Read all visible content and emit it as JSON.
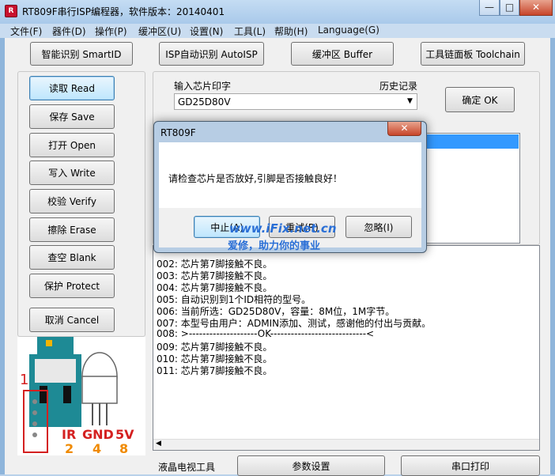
{
  "window": {
    "title": "RT809F串行ISP编程器，软件版本：20140401",
    "caption_buttons": [
      "—",
      "□",
      "✕"
    ]
  },
  "menu": [
    "文件(F)",
    "器件(D)",
    "操作(P)",
    "缓冲区(U)",
    "设置(N)",
    "工具(L)",
    "帮助(H)",
    "Language(G)"
  ],
  "toolbar": {
    "smartid": "智能识别 SmartID",
    "autoisp": "ISP自动识别 AutoISP",
    "buffer": "缓冲区 Buffer",
    "toolchain": "工具链面板 Toolchain"
  },
  "actions": {
    "read": "读取 Read",
    "save": "保存 Save",
    "open": "打开 Open",
    "write": "写入 Write",
    "verify": "校验 Verify",
    "erase": "擦除 Erase",
    "blank": "查空 Blank",
    "protect": "保护 Protect",
    "cancel": "取消 Cancel"
  },
  "chip_input": {
    "label": "输入芯片印字",
    "history_label": "历史记录",
    "value": "GD25D80V",
    "ok": "确定 OK"
  },
  "log": [
    "002: 芯片第7脚接触不良。",
    "003: 芯片第7脚接触不良。",
    "004: 芯片第7脚接触不良。",
    "005: 自动识别到1个ID相符的型号。",
    "006: 当前所选：GD25D80V，容量：8M位，1M字节。",
    "007: 本型号由用户：ADMIN添加、测试，感谢他的付出与贡献。",
    "008: >--------------------OK----------------------------<",
    "009: 芯片第7脚接触不良。",
    "010: 芯片第7脚接触不良。",
    "011: 芯片第7脚接触不良。"
  ],
  "bottom": {
    "lcd_tools": "液晶电视工具",
    "params": "参数设置",
    "serial_print": "串口打印"
  },
  "dialog": {
    "title": "RT809F",
    "message": "请检查芯片是否放好,引脚是否接触良好！",
    "abort": "中止(A)",
    "retry": "重试(R)",
    "ignore": "忽略(I)"
  },
  "watermark": {
    "url": "www.iFix.net.cn",
    "slogan": "爱修，助力你的事业"
  },
  "chip_diagram": {
    "pin1": "1",
    "labels": [
      "IR",
      "GND",
      "5V"
    ],
    "numbers": [
      "2",
      "4",
      "8"
    ]
  },
  "colors": {
    "selection": "#3399ff",
    "watermark": "#2a6fd6",
    "diagram_red": "#d42020",
    "diagram_orange": "#f08a00"
  }
}
